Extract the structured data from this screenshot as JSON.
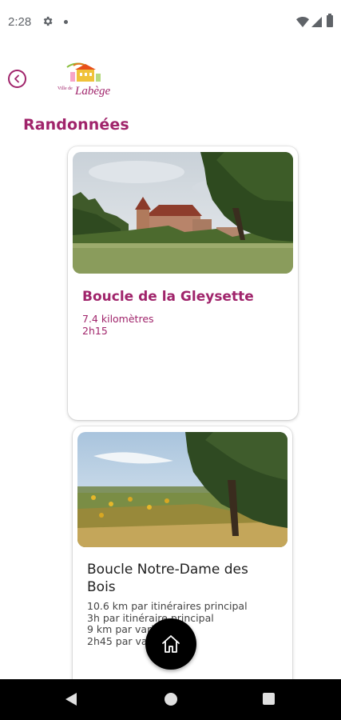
{
  "status_bar": {
    "time": "2:28",
    "icons": [
      "gear-icon",
      "notification-dot-icon",
      "wifi-icon",
      "signal-icon",
      "battery-icon"
    ]
  },
  "header": {
    "back_icon": "chevron-left-icon",
    "logo_text_small": "Ville de",
    "logo_text": "Labège"
  },
  "page": {
    "title": "Randonnées"
  },
  "cards": [
    {
      "title": "Boucle de la Gleysette",
      "lines": [
        "7.4 kilomètres",
        "2h15"
      ],
      "image": "chateau-photo"
    },
    {
      "title": "Boucle Notre-Dame des Bois",
      "lines": [
        "10.6 km par itinéraires principal",
        "3h par itinéraire principal",
        "9 km par variante",
        "2h45 par variante"
      ],
      "image": "sunflower-field-photo"
    }
  ],
  "fab": {
    "icon": "home-icon"
  },
  "colors": {
    "accent": "#a0246b",
    "fab": "#000000",
    "nav_bar": "#000000"
  },
  "nav_bar": {
    "back_icon": "triangle-back-icon",
    "home_icon": "circle-home-icon",
    "recents_icon": "square-recents-icon"
  }
}
